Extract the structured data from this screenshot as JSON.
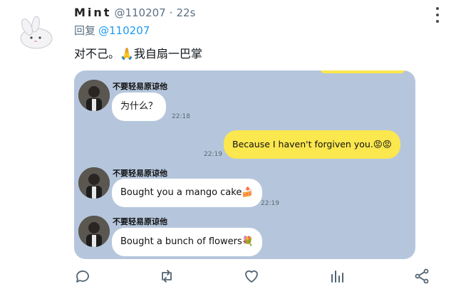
{
  "post": {
    "display_name": "Mint",
    "handle": "@110207",
    "separator": "·",
    "time": "22s",
    "reply_prefix": "回复",
    "reply_to": "@110207",
    "text": "对不己。🙏我自扇一巴掌"
  },
  "chat": {
    "messages": [
      {
        "sender": "不要轻易原谅他",
        "text": "为什么？",
        "time": "22:18",
        "side": "left"
      },
      {
        "text": "Because I haven't forgiven you.😡😡",
        "time": "22:19",
        "side": "right"
      },
      {
        "sender": "不要轻易原谅他",
        "text": "Bought you a mango cake🍰",
        "time": "22:19",
        "side": "left"
      },
      {
        "sender": "不要轻易原谅他",
        "text": "Bought a bunch of flowers💐",
        "side": "left"
      }
    ]
  },
  "actions": [
    "reply-icon",
    "retweet-icon",
    "like-icon",
    "analytics-icon",
    "share-icon"
  ],
  "colors": {
    "chat_bg": "#b5c6dc",
    "my_bubble": "#fbe74e",
    "link": "#1d9bf0"
  }
}
